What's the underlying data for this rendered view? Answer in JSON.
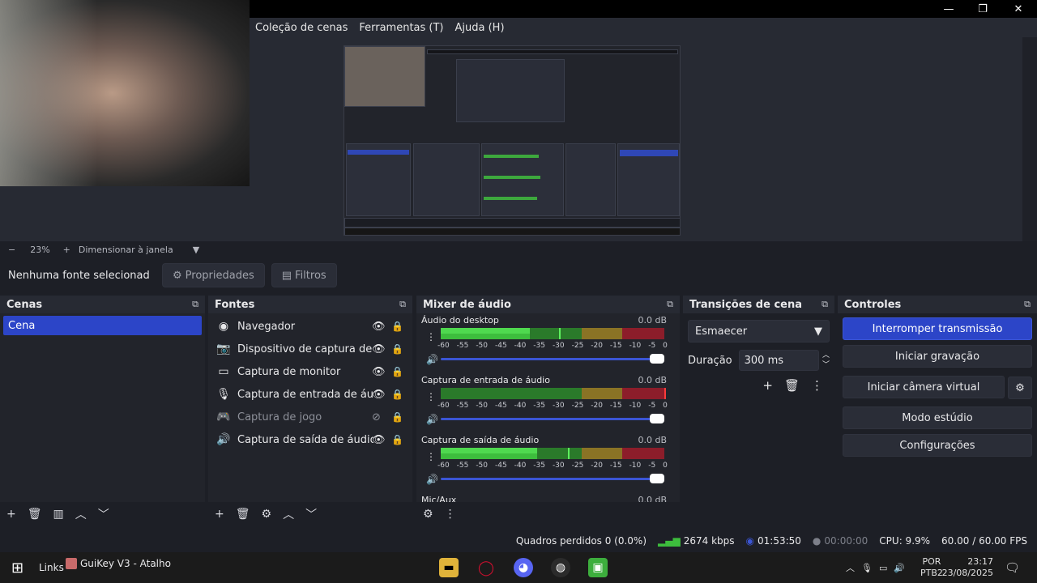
{
  "menu": {
    "items": [
      "Coleção de cenas",
      "Ferramentas (T)",
      "Ajuda (H)"
    ]
  },
  "window_controls": {
    "minimize": "—",
    "maximize": "❐",
    "close": "✕"
  },
  "preview": {
    "zoom_label": "23%",
    "fit_label": "Dimensionar à janela"
  },
  "source_toolbar": {
    "no_source": "Nenhuma fonte selecionad",
    "properties": "Propriedades",
    "filters": "Filtros"
  },
  "scenes": {
    "title": "Cenas",
    "items": [
      "Cena"
    ]
  },
  "sources": {
    "title": "Fontes",
    "items": [
      {
        "label": "Navegador",
        "icon": "globe-icon"
      },
      {
        "label": "Dispositivo de captura de víde",
        "icon": "camera-icon"
      },
      {
        "label": "Captura de monitor",
        "icon": "monitor-icon"
      },
      {
        "label": "Captura de entrada de áudio",
        "icon": "microphone-icon"
      },
      {
        "label": "Captura de jogo",
        "icon": "gamepad-icon"
      },
      {
        "label": "Captura de saída de áudio",
        "icon": "speaker-icon"
      }
    ]
  },
  "mixer": {
    "title": "Mixer de áudio",
    "ticks": [
      "-60",
      "-55",
      "-50",
      "-45",
      "-40",
      "-35",
      "-30",
      "-25",
      "-20",
      "-15",
      "-10",
      "-5",
      "0"
    ],
    "channels": [
      {
        "name": "Áudio do desktop",
        "db": "0.0 dB",
        "level": 0.4,
        "peak": 0.53
      },
      {
        "name": "Captura de entrada de áudio",
        "db": "0.0 dB",
        "level": 0.0,
        "peak": 1.0
      },
      {
        "name": "Captura de saída de áudio",
        "db": "0.0 dB",
        "level": 0.43,
        "peak": 0.57
      }
    ],
    "cut_label": "Mic/Aux",
    "cut_db": "0.0 dB"
  },
  "transitions": {
    "title": "Transições de cena",
    "selected": "Esmaecer",
    "duration_label": "Duração",
    "duration_value": "300 ms"
  },
  "controls": {
    "title": "Controles",
    "stop_stream": "Interromper transmissão",
    "start_recording": "Iniciar gravação",
    "virtual_camera": "Iniciar câmera virtual",
    "studio_mode": "Modo estúdio",
    "settings": "Configurações"
  },
  "status": {
    "dropped": "Quadros perdidos 0 (0.0%)",
    "bitrate": "2674 kbps",
    "stream_time": "01:53:50",
    "rec_time": "00:00:00",
    "cpu": "CPU: 9.9%",
    "fps": "60.00 / 60.00 FPS"
  },
  "taskbar": {
    "links": "Links",
    "shortcut": "GuiKey V3 - Atalho",
    "lang1": "POR",
    "lang2": "PTB2",
    "time": "23:17",
    "date": "23/08/2025"
  },
  "colors": {
    "accent": "#2c45c8",
    "meter_green": "#4fd94f",
    "meter_yellow": "#8a7325",
    "meter_red": "#8c1d2a"
  }
}
